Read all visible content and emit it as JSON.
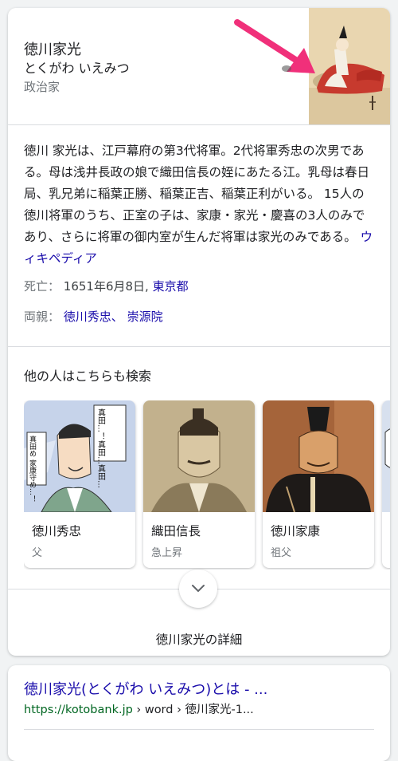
{
  "entity": {
    "name": "徳川家光",
    "reading": "とくがわ いえみつ",
    "type": "政治家"
  },
  "description": {
    "text": "徳川 家光は、江戸幕府の第3代将軍。2代将軍秀忠の次男である。母は浅井長政の娘で織田信長の姪にあたる江。乳母は春日局、乳兄弟に稲葉正勝、稲葉正吉、稲葉正利がいる。 15人の徳川将軍のうち、正室の子は、家康・家光・慶喜の3人のみであり、さらに将軍の御内室が生んだ将軍は家光のみである。",
    "source_link": "ウィキペディア"
  },
  "facts": {
    "death_label": "死亡：",
    "death_value": "1651年6月8日,",
    "death_place": "東京都",
    "parents_label": "両親：",
    "parent1": "徳川秀忠、",
    "parent2": "崇源院"
  },
  "related": {
    "title": "他の人はこちらも検索",
    "items": [
      {
        "name": "徳川秀忠",
        "relation": "父"
      },
      {
        "name": "織田信長",
        "relation": "急上昇"
      },
      {
        "name": "徳川家康",
        "relation": "祖父"
      },
      {
        "name": "徳",
        "relation": "急"
      }
    ]
  },
  "manga_text": {
    "bubble1": "真田…！真田…真田…",
    "bubble2": "真田め 家康守め…！"
  },
  "more": {
    "label": "徳川家光の詳細"
  },
  "result": {
    "title": "徳川家光(とくがわ いえみつ)とは - ...",
    "url_domain": "https://kotobank.jp",
    "url_path": " › word › 徳川家光-1..."
  },
  "colors": {
    "link": "#1a0dab",
    "annotation_arrow": "#f0307a",
    "url_green": "#006621"
  },
  "icons": {
    "more": "chevron-down-icon",
    "annotation": "arrow-icon"
  }
}
